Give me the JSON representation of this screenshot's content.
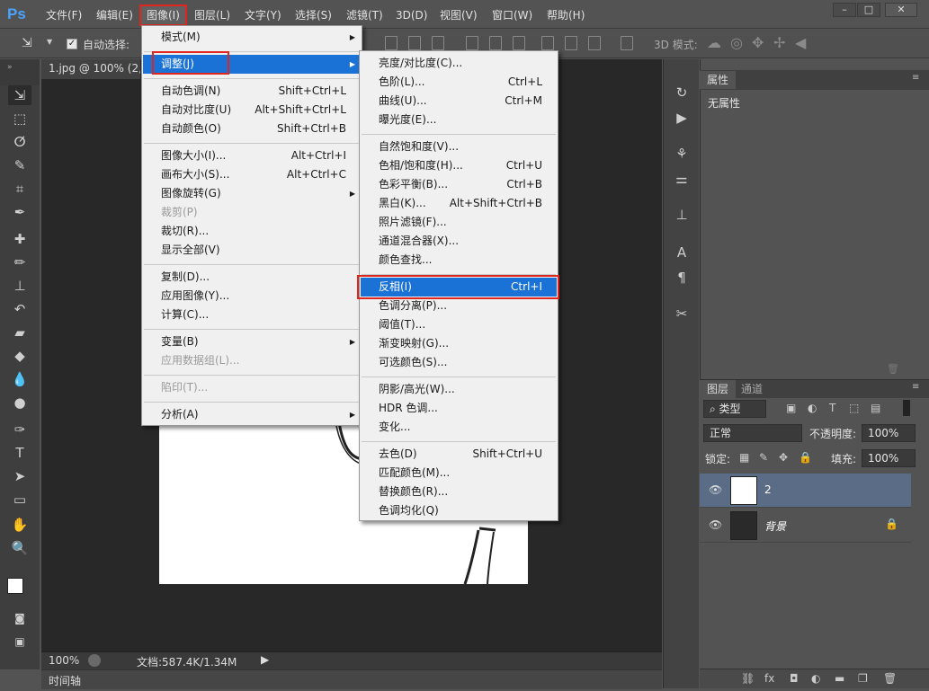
{
  "app": {
    "logo": "Ps"
  },
  "menubar": {
    "items": [
      "文件(F)",
      "编辑(E)",
      "图像(I)",
      "图层(L)",
      "文字(Y)",
      "选择(S)",
      "滤镜(T)",
      "3D(D)",
      "视图(V)",
      "窗口(W)",
      "帮助(H)"
    ],
    "window_buttons": [
      "–",
      "□",
      "✕"
    ]
  },
  "options": {
    "auto_select": "自动选择:",
    "mode_3d": "3D 模式:"
  },
  "document": {
    "tab_title": "1.jpg @ 100% (2, F"
  },
  "status": {
    "zoom": "100%",
    "doc_info": "文档:587.4K/1.34M"
  },
  "timeline": {
    "label": "时间轴"
  },
  "properties_panel": {
    "tab": "属性",
    "content": "无属性"
  },
  "layers_panel": {
    "tabs": [
      "图层",
      "通道"
    ],
    "filter_kind": "类型",
    "blend_mode": "正常",
    "opacity_label": "不透明度:",
    "opacity_value": "100%",
    "lock_label": "锁定:",
    "fill_label": "填充:",
    "fill_value": "100%",
    "layers": [
      {
        "name": "2"
      },
      {
        "name": "背景"
      }
    ]
  },
  "image_menu": {
    "items": [
      {
        "label": "模式(M)",
        "shortcut": "",
        "submenu": true,
        "disabled": false
      },
      {
        "sep": true
      },
      {
        "label": "调整(J)",
        "shortcut": "",
        "submenu": true,
        "disabled": false,
        "highlighted": true
      },
      {
        "sep": true
      },
      {
        "label": "自动色调(N)",
        "shortcut": "Shift+Ctrl+L",
        "disabled": false
      },
      {
        "label": "自动对比度(U)",
        "shortcut": "Alt+Shift+Ctrl+L",
        "disabled": false
      },
      {
        "label": "自动颜色(O)",
        "shortcut": "Shift+Ctrl+B",
        "disabled": false
      },
      {
        "sep": true
      },
      {
        "label": "图像大小(I)...",
        "shortcut": "Alt+Ctrl+I",
        "disabled": false
      },
      {
        "label": "画布大小(S)...",
        "shortcut": "Alt+Ctrl+C",
        "disabled": false
      },
      {
        "label": "图像旋转(G)",
        "shortcut": "",
        "submenu": true,
        "disabled": false
      },
      {
        "label": "裁剪(P)",
        "shortcut": "",
        "disabled": true
      },
      {
        "label": "裁切(R)...",
        "shortcut": "",
        "disabled": false
      },
      {
        "label": "显示全部(V)",
        "shortcut": "",
        "disabled": false
      },
      {
        "sep": true
      },
      {
        "label": "复制(D)...",
        "shortcut": "",
        "disabled": false
      },
      {
        "label": "应用图像(Y)...",
        "shortcut": "",
        "disabled": false
      },
      {
        "label": "计算(C)...",
        "shortcut": "",
        "disabled": false
      },
      {
        "sep": true
      },
      {
        "label": "变量(B)",
        "shortcut": "",
        "submenu": true,
        "disabled": false
      },
      {
        "label": "应用数据组(L)...",
        "shortcut": "",
        "disabled": true
      },
      {
        "sep": true
      },
      {
        "label": "陷印(T)...",
        "shortcut": "",
        "disabled": true
      },
      {
        "sep": true
      },
      {
        "label": "分析(A)",
        "shortcut": "",
        "submenu": true,
        "disabled": false
      }
    ]
  },
  "adjust_menu": {
    "items": [
      {
        "label": "亮度/对比度(C)...",
        "shortcut": ""
      },
      {
        "label": "色阶(L)...",
        "shortcut": "Ctrl+L"
      },
      {
        "label": "曲线(U)...",
        "shortcut": "Ctrl+M"
      },
      {
        "label": "曝光度(E)...",
        "shortcut": ""
      },
      {
        "sep": true
      },
      {
        "label": "自然饱和度(V)...",
        "shortcut": ""
      },
      {
        "label": "色相/饱和度(H)...",
        "shortcut": "Ctrl+U"
      },
      {
        "label": "色彩平衡(B)...",
        "shortcut": "Ctrl+B"
      },
      {
        "label": "黑白(K)...",
        "shortcut": "Alt+Shift+Ctrl+B"
      },
      {
        "label": "照片滤镜(F)...",
        "shortcut": ""
      },
      {
        "label": "通道混合器(X)...",
        "shortcut": ""
      },
      {
        "label": "颜色查找...",
        "shortcut": ""
      },
      {
        "sep": true
      },
      {
        "label": "反相(I)",
        "shortcut": "Ctrl+I",
        "highlighted": true
      },
      {
        "label": "色调分离(P)...",
        "shortcut": ""
      },
      {
        "label": "阈值(T)...",
        "shortcut": ""
      },
      {
        "label": "渐变映射(G)...",
        "shortcut": ""
      },
      {
        "label": "可选颜色(S)...",
        "shortcut": ""
      },
      {
        "sep": true
      },
      {
        "label": "阴影/高光(W)...",
        "shortcut": ""
      },
      {
        "label": "HDR 色调...",
        "shortcut": ""
      },
      {
        "label": "变化...",
        "shortcut": ""
      },
      {
        "sep": true
      },
      {
        "label": "去色(D)",
        "shortcut": "Shift+Ctrl+U"
      },
      {
        "label": "匹配颜色(M)...",
        "shortcut": ""
      },
      {
        "label": "替换颜色(R)...",
        "shortcut": ""
      },
      {
        "label": "色调均化(Q)",
        "shortcut": ""
      }
    ]
  },
  "colors": {
    "highlight": "#1a72d6",
    "annotation_red": "#e0251f",
    "ps_blue": "#4aa3ff"
  }
}
